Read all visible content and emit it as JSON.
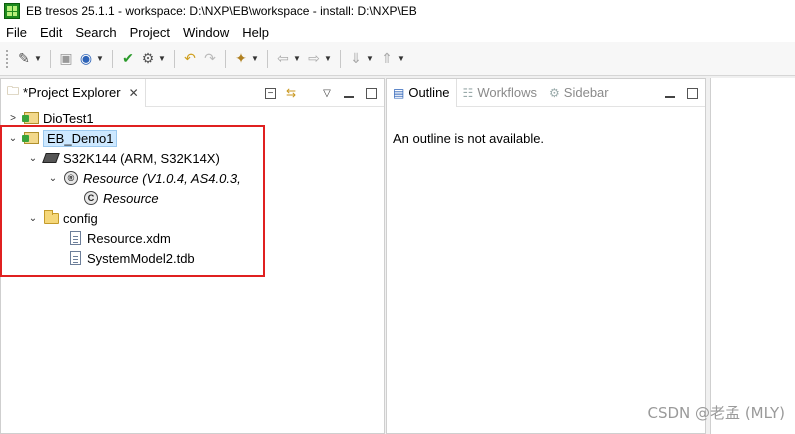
{
  "window": {
    "title": "EB tresos 25.1.1 - workspace: D:\\NXP\\EB\\workspace - install: D:\\NXP\\EB"
  },
  "menu": {
    "items": [
      {
        "label": "File"
      },
      {
        "label": "Edit"
      },
      {
        "label": "Search"
      },
      {
        "label": "Project"
      },
      {
        "label": "Window"
      },
      {
        "label": "Help"
      }
    ]
  },
  "project_explorer": {
    "tab_label": "*Project Explorer",
    "tree": {
      "dio": "DioTest1",
      "demo": "EB_Demo1",
      "chip": "S32K144 (ARM, S32K14X)",
      "resource_module": "Resource (V1.0.4, AS4.0.3,",
      "resource": "Resource",
      "config": "config",
      "file1": "Resource.xdm",
      "file2": "SystemModel2.tdb"
    }
  },
  "outline_panel": {
    "tabs": [
      {
        "label": "Outline"
      },
      {
        "label": "Workflows"
      },
      {
        "label": "Sidebar"
      }
    ],
    "message": "An outline is not available."
  },
  "watermark": "CSDN @老孟 (MLY)",
  "colors": {
    "highlight": "#e02020",
    "selection": "#cde8ff"
  }
}
